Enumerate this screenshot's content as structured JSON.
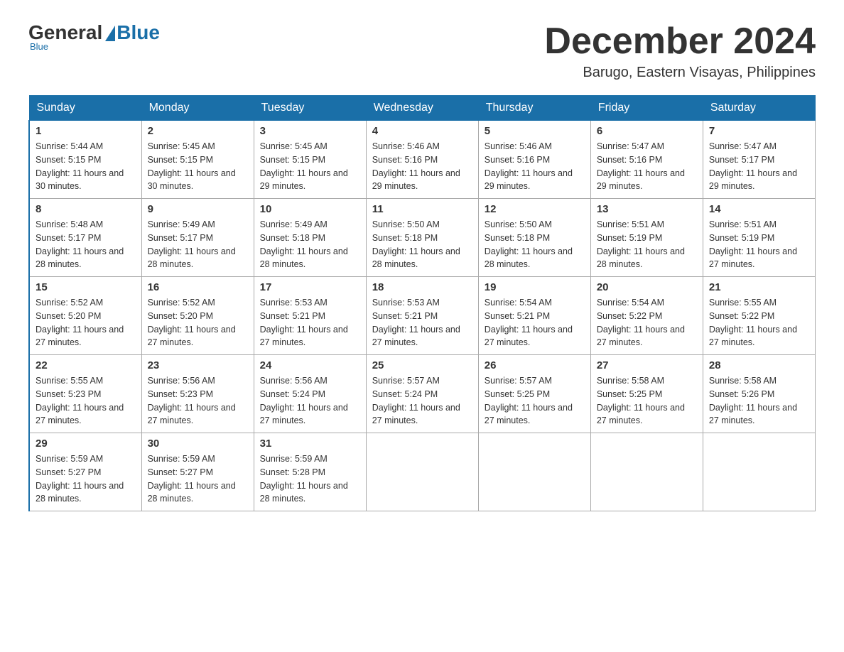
{
  "logo": {
    "general": "General",
    "blue": "Blue",
    "subtitle": "Blue"
  },
  "header": {
    "month_year": "December 2024",
    "location": "Barugo, Eastern Visayas, Philippines"
  },
  "days_of_week": [
    "Sunday",
    "Monday",
    "Tuesday",
    "Wednesday",
    "Thursday",
    "Friday",
    "Saturday"
  ],
  "weeks": [
    [
      {
        "day": "1",
        "sunrise": "Sunrise: 5:44 AM",
        "sunset": "Sunset: 5:15 PM",
        "daylight": "Daylight: 11 hours and 30 minutes."
      },
      {
        "day": "2",
        "sunrise": "Sunrise: 5:45 AM",
        "sunset": "Sunset: 5:15 PM",
        "daylight": "Daylight: 11 hours and 30 minutes."
      },
      {
        "day": "3",
        "sunrise": "Sunrise: 5:45 AM",
        "sunset": "Sunset: 5:15 PM",
        "daylight": "Daylight: 11 hours and 29 minutes."
      },
      {
        "day": "4",
        "sunrise": "Sunrise: 5:46 AM",
        "sunset": "Sunset: 5:16 PM",
        "daylight": "Daylight: 11 hours and 29 minutes."
      },
      {
        "day": "5",
        "sunrise": "Sunrise: 5:46 AM",
        "sunset": "Sunset: 5:16 PM",
        "daylight": "Daylight: 11 hours and 29 minutes."
      },
      {
        "day": "6",
        "sunrise": "Sunrise: 5:47 AM",
        "sunset": "Sunset: 5:16 PM",
        "daylight": "Daylight: 11 hours and 29 minutes."
      },
      {
        "day": "7",
        "sunrise": "Sunrise: 5:47 AM",
        "sunset": "Sunset: 5:17 PM",
        "daylight": "Daylight: 11 hours and 29 minutes."
      }
    ],
    [
      {
        "day": "8",
        "sunrise": "Sunrise: 5:48 AM",
        "sunset": "Sunset: 5:17 PM",
        "daylight": "Daylight: 11 hours and 28 minutes."
      },
      {
        "day": "9",
        "sunrise": "Sunrise: 5:49 AM",
        "sunset": "Sunset: 5:17 PM",
        "daylight": "Daylight: 11 hours and 28 minutes."
      },
      {
        "day": "10",
        "sunrise": "Sunrise: 5:49 AM",
        "sunset": "Sunset: 5:18 PM",
        "daylight": "Daylight: 11 hours and 28 minutes."
      },
      {
        "day": "11",
        "sunrise": "Sunrise: 5:50 AM",
        "sunset": "Sunset: 5:18 PM",
        "daylight": "Daylight: 11 hours and 28 minutes."
      },
      {
        "day": "12",
        "sunrise": "Sunrise: 5:50 AM",
        "sunset": "Sunset: 5:18 PM",
        "daylight": "Daylight: 11 hours and 28 minutes."
      },
      {
        "day": "13",
        "sunrise": "Sunrise: 5:51 AM",
        "sunset": "Sunset: 5:19 PM",
        "daylight": "Daylight: 11 hours and 28 minutes."
      },
      {
        "day": "14",
        "sunrise": "Sunrise: 5:51 AM",
        "sunset": "Sunset: 5:19 PM",
        "daylight": "Daylight: 11 hours and 27 minutes."
      }
    ],
    [
      {
        "day": "15",
        "sunrise": "Sunrise: 5:52 AM",
        "sunset": "Sunset: 5:20 PM",
        "daylight": "Daylight: 11 hours and 27 minutes."
      },
      {
        "day": "16",
        "sunrise": "Sunrise: 5:52 AM",
        "sunset": "Sunset: 5:20 PM",
        "daylight": "Daylight: 11 hours and 27 minutes."
      },
      {
        "day": "17",
        "sunrise": "Sunrise: 5:53 AM",
        "sunset": "Sunset: 5:21 PM",
        "daylight": "Daylight: 11 hours and 27 minutes."
      },
      {
        "day": "18",
        "sunrise": "Sunrise: 5:53 AM",
        "sunset": "Sunset: 5:21 PM",
        "daylight": "Daylight: 11 hours and 27 minutes."
      },
      {
        "day": "19",
        "sunrise": "Sunrise: 5:54 AM",
        "sunset": "Sunset: 5:21 PM",
        "daylight": "Daylight: 11 hours and 27 minutes."
      },
      {
        "day": "20",
        "sunrise": "Sunrise: 5:54 AM",
        "sunset": "Sunset: 5:22 PM",
        "daylight": "Daylight: 11 hours and 27 minutes."
      },
      {
        "day": "21",
        "sunrise": "Sunrise: 5:55 AM",
        "sunset": "Sunset: 5:22 PM",
        "daylight": "Daylight: 11 hours and 27 minutes."
      }
    ],
    [
      {
        "day": "22",
        "sunrise": "Sunrise: 5:55 AM",
        "sunset": "Sunset: 5:23 PM",
        "daylight": "Daylight: 11 hours and 27 minutes."
      },
      {
        "day": "23",
        "sunrise": "Sunrise: 5:56 AM",
        "sunset": "Sunset: 5:23 PM",
        "daylight": "Daylight: 11 hours and 27 minutes."
      },
      {
        "day": "24",
        "sunrise": "Sunrise: 5:56 AM",
        "sunset": "Sunset: 5:24 PM",
        "daylight": "Daylight: 11 hours and 27 minutes."
      },
      {
        "day": "25",
        "sunrise": "Sunrise: 5:57 AM",
        "sunset": "Sunset: 5:24 PM",
        "daylight": "Daylight: 11 hours and 27 minutes."
      },
      {
        "day": "26",
        "sunrise": "Sunrise: 5:57 AM",
        "sunset": "Sunset: 5:25 PM",
        "daylight": "Daylight: 11 hours and 27 minutes."
      },
      {
        "day": "27",
        "sunrise": "Sunrise: 5:58 AM",
        "sunset": "Sunset: 5:25 PM",
        "daylight": "Daylight: 11 hours and 27 minutes."
      },
      {
        "day": "28",
        "sunrise": "Sunrise: 5:58 AM",
        "sunset": "Sunset: 5:26 PM",
        "daylight": "Daylight: 11 hours and 27 minutes."
      }
    ],
    [
      {
        "day": "29",
        "sunrise": "Sunrise: 5:59 AM",
        "sunset": "Sunset: 5:27 PM",
        "daylight": "Daylight: 11 hours and 28 minutes."
      },
      {
        "day": "30",
        "sunrise": "Sunrise: 5:59 AM",
        "sunset": "Sunset: 5:27 PM",
        "daylight": "Daylight: 11 hours and 28 minutes."
      },
      {
        "day": "31",
        "sunrise": "Sunrise: 5:59 AM",
        "sunset": "Sunset: 5:28 PM",
        "daylight": "Daylight: 11 hours and 28 minutes."
      },
      null,
      null,
      null,
      null
    ]
  ]
}
